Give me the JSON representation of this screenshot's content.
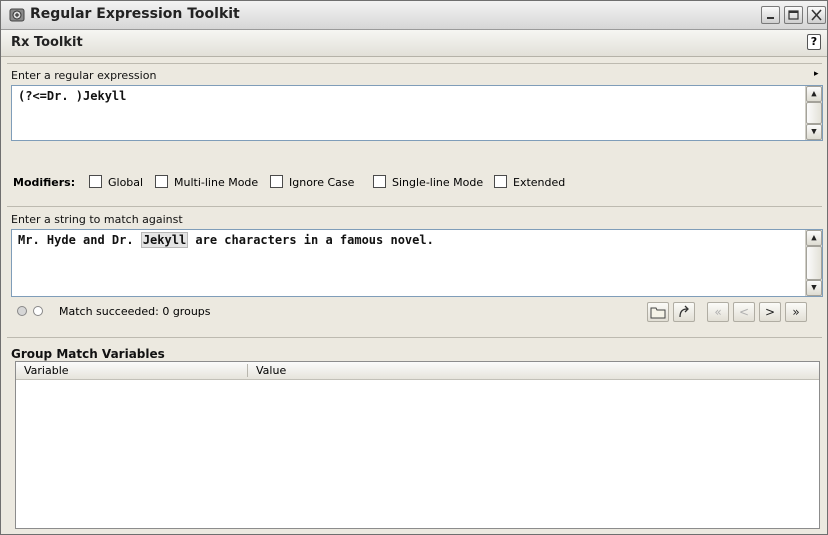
{
  "window": {
    "title": "Regular Expression Toolkit",
    "panel_title": "Rx Toolkit",
    "help_glyph": "?"
  },
  "regex_section": {
    "label": "Enter a regular expression",
    "value": "(?<=Dr. )Jekyll"
  },
  "modifiers": {
    "label": "Modifiers:",
    "options": [
      {
        "label": "Global",
        "checked": false
      },
      {
        "label": "Multi-line Mode",
        "checked": false
      },
      {
        "label": "Ignore Case",
        "checked": false
      },
      {
        "label": "Single-line Mode",
        "checked": false
      },
      {
        "label": "Extended",
        "checked": false
      }
    ]
  },
  "match_section": {
    "label": "Enter a string to match against",
    "before": "Mr. Hyde and Dr. ",
    "highlight": "Jekyll",
    "after": " are characters in a famous novel."
  },
  "status": {
    "text": "Match succeeded: 0 groups"
  },
  "nav": {
    "first": "«",
    "prev": "<",
    "next": ">",
    "last": "»"
  },
  "groups": {
    "title": "Group Match Variables",
    "columns": [
      "Variable",
      "Value"
    ],
    "rows": []
  },
  "colors": {
    "highlight": "#e4e4e4",
    "textbox_border": "#7f9db9"
  }
}
